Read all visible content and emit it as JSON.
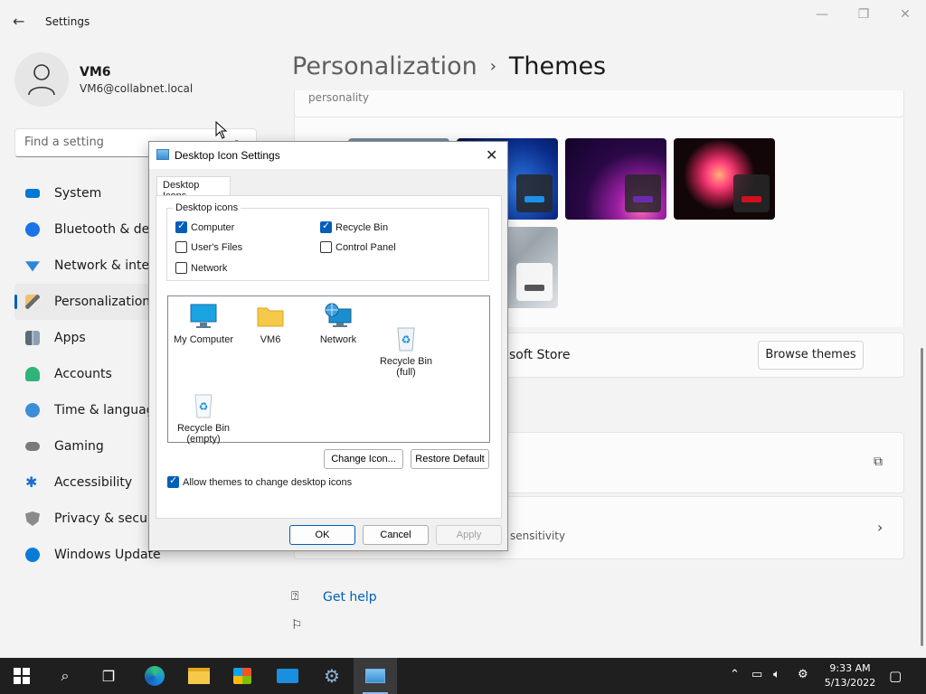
{
  "settings": {
    "title": "Settings",
    "user": {
      "name": "VM6",
      "email": "VM6@collabnet.local"
    },
    "search_placeholder": "Find a setting",
    "nav": [
      {
        "label": "System",
        "icon": "monitor-icon",
        "color": "#0078d4"
      },
      {
        "label": "Bluetooth & devi",
        "icon": "bluetooth-icon",
        "color": "#1a73e8"
      },
      {
        "label": "Network & intern",
        "icon": "wifi-icon",
        "color": "#2b88d8"
      },
      {
        "label": "Personalization",
        "icon": "brush-icon",
        "color": "#c68a3c"
      },
      {
        "label": "Apps",
        "icon": "apps-icon",
        "color": "#5a6a7a"
      },
      {
        "label": "Accounts",
        "icon": "person-icon",
        "color": "#2fb57a"
      },
      {
        "label": "Time & language",
        "icon": "clock-icon",
        "color": "#3c8ed8"
      },
      {
        "label": "Gaming",
        "icon": "gamepad-icon",
        "color": "#7a7a7a"
      },
      {
        "label": "Accessibility",
        "icon": "accessibility-icon",
        "color": "#1a6fc9"
      },
      {
        "label": "Privacy & security",
        "icon": "shield-icon",
        "color": "#8a8a8a"
      },
      {
        "label": "Windows Update",
        "icon": "update-icon",
        "color": "#0a7cd8"
      }
    ],
    "breadcrumb": {
      "parent": "Personalization",
      "current": "Themes"
    },
    "personality_text": "personality",
    "store_text": "soft Store",
    "browse_label": "Browse themes",
    "sensitivity_text": "sensitivity",
    "get_help": "Get help"
  },
  "dialog": {
    "title": "Desktop Icon Settings",
    "tab": "Desktop Icons",
    "group_label": "Desktop icons",
    "checkboxes": [
      {
        "label": "Computer",
        "checked": true
      },
      {
        "label": "Recycle Bin",
        "checked": true
      },
      {
        "label": "User's Files",
        "checked": false
      },
      {
        "label": "Control Panel",
        "checked": false
      },
      {
        "label": "Network",
        "checked": false
      }
    ],
    "icons": [
      {
        "label": "My Computer"
      },
      {
        "label": "VM6"
      },
      {
        "label": "Network"
      },
      {
        "label": "Recycle Bin\n(full)"
      },
      {
        "label": "Recycle Bin\n(empty)"
      }
    ],
    "change_icon": "Change Icon...",
    "restore_default": "Restore Default",
    "allow_themes": {
      "label": "Allow themes to change desktop icons",
      "checked": true
    },
    "ok": "OK",
    "cancel": "Cancel",
    "apply": "Apply"
  },
  "taskbar": {
    "time": "9:33 AM",
    "date": "5/13/2022"
  },
  "colors": {
    "accent": "#005fb8"
  }
}
